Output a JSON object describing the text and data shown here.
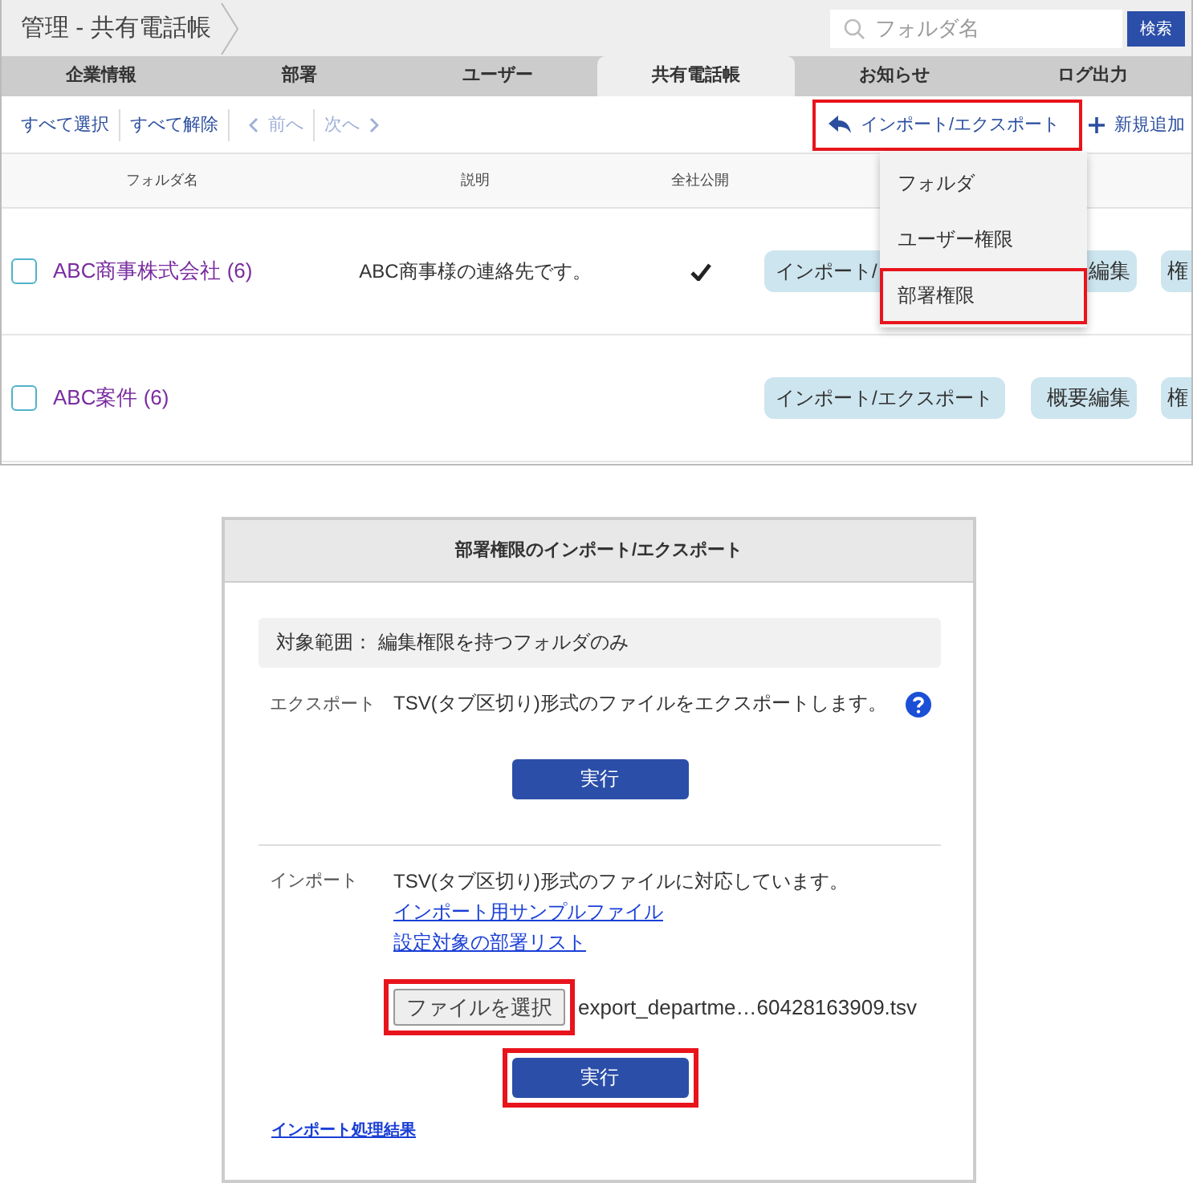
{
  "header": {
    "breadcrumb": "管理 - 共有電話帳",
    "search": {
      "placeholder": "フォルダ名",
      "button": "検索"
    }
  },
  "tabs": [
    {
      "label": "企業情報",
      "selected": false
    },
    {
      "label": "部署",
      "selected": false
    },
    {
      "label": "ユーザー",
      "selected": false
    },
    {
      "label": "共有電話帳",
      "selected": true
    },
    {
      "label": "お知らせ",
      "selected": false
    },
    {
      "label": "ログ出力",
      "selected": false
    }
  ],
  "toolbar": {
    "links": [
      {
        "label": "すべて選択",
        "disabled": false,
        "kind": "plain"
      },
      {
        "label": "すべて解除",
        "disabled": false,
        "kind": "plain"
      },
      {
        "label": "前へ",
        "disabled": true,
        "kind": "prev"
      },
      {
        "label": "次へ",
        "disabled": true,
        "kind": "next"
      }
    ],
    "import_export": {
      "label": "インポート/エクスポート",
      "highlighted": true
    },
    "add": "新規追加"
  },
  "table": {
    "columns": [
      "フォルダ名",
      "説明",
      "全社公開"
    ],
    "rows": [
      {
        "checked": false,
        "name": "ABC商事株式会社 (6)",
        "description": "ABC商事様の連絡先です。",
        "public": true,
        "actions": [
          "インポート/",
          "編集",
          "権"
        ]
      },
      {
        "checked": false,
        "name": "ABC案件 (6)",
        "public": false,
        "actions": [
          "インポート/エクスポート",
          "概要編集",
          "権"
        ]
      }
    ]
  },
  "menu": [
    {
      "label": "フォルダ",
      "highlighted": false
    },
    {
      "label": "ユーザー権限",
      "highlighted": false
    },
    {
      "label": "部署権限",
      "highlighted": true
    }
  ],
  "dialog": {
    "title": "部署権限のインポート/エクスポート",
    "scope": "対象範囲： 編集権限を持つフォルダのみ",
    "export": {
      "label": "エクスポート",
      "text": "TSV(タブ区切り)形式のファイルをエクスポートします。",
      "button": {
        "label": "実行",
        "highlighted": false
      }
    },
    "import": {
      "label": "インポート",
      "text": "TSV(タブ区切り)形式のファイルに対応しています。",
      "links": [
        "インポート用サンプルファイル",
        "設定対象の部署リスト"
      ],
      "file_button": {
        "label": "ファイルを選択",
        "highlighted": true
      },
      "file_name": "export_departme…60428163909.tsv",
      "button": {
        "label": "実行",
        "highlighted": true
      }
    },
    "result_link": "インポート処理結果"
  }
}
